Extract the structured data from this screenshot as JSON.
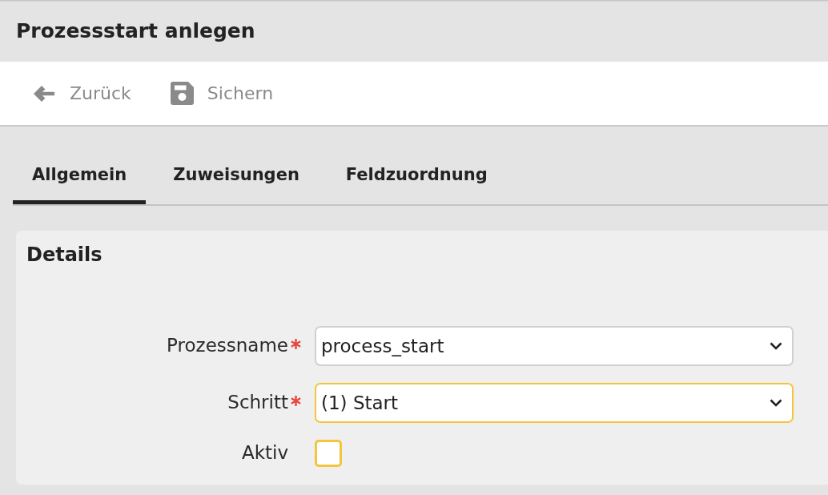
{
  "window": {
    "title": "Prozessstart anlegen"
  },
  "toolbar": [
    {
      "kind": "back",
      "label": "Zurück"
    },
    {
      "kind": "save",
      "label": "Sichern"
    }
  ],
  "tabs": [
    {
      "label": "Allgemein",
      "selected": true
    },
    {
      "label": "Zuweisungen",
      "selected": false
    },
    {
      "label": "Feldzuordnung",
      "selected": false
    }
  ],
  "details": {
    "title": "Details",
    "fields": [
      {
        "kind": "select",
        "label": "Prozessname",
        "required": true,
        "value": "process_start",
        "highlighted": false
      },
      {
        "kind": "select",
        "label": "Schritt",
        "required": true,
        "value": "(1) Start",
        "highlighted": true
      },
      {
        "kind": "checkbox",
        "label": "Aktiv",
        "required": false,
        "checked": false
      }
    ]
  }
}
